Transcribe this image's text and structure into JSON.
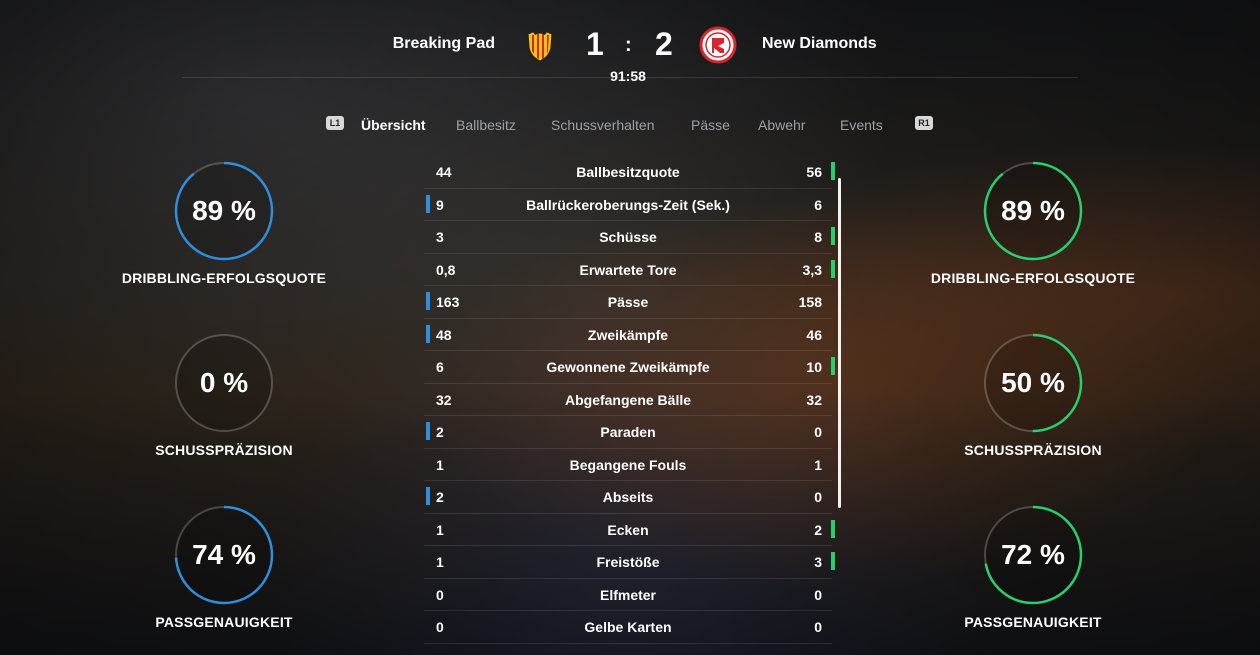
{
  "match": {
    "home_team": "Breaking Pad",
    "away_team": "New Diamonds",
    "home_score": "1",
    "separator": ":",
    "away_score": "2",
    "clock": "91:58"
  },
  "tabs": {
    "left_button": "L1",
    "right_button": "R1",
    "items": [
      "Übersicht",
      "Ballbesitz",
      "Schussverhalten",
      "Pässe",
      "Abwehr",
      "Events"
    ],
    "active": "Übersicht"
  },
  "colors": {
    "home_accent": "#2d8fde",
    "away_accent": "#27d06a"
  },
  "home_rings": [
    {
      "value": "89 %",
      "fraction": 0.89,
      "label": "DRIBBLING-ERFOLGSQUOTE"
    },
    {
      "value": "0 %",
      "fraction": 0.0,
      "label": "SCHUSSPRÄZISION"
    },
    {
      "value": "74 %",
      "fraction": 0.74,
      "label": "PASSGENAUIGKEIT"
    }
  ],
  "away_rings": [
    {
      "value": "89 %",
      "fraction": 0.89,
      "label": "DRIBBLING-ERFOLGSQUOTE"
    },
    {
      "value": "50 %",
      "fraction": 0.5,
      "label": "SCHUSSPRÄZISION"
    },
    {
      "value": "72 %",
      "fraction": 0.72,
      "label": "PASSGENAUIGKEIT"
    }
  ],
  "stats": [
    {
      "home": "44",
      "name": "Ballbesitzquote",
      "away": "56",
      "leader": "away"
    },
    {
      "home": "9",
      "name": "Ballrückeroberungs-Zeit (Sek.)",
      "away": "6",
      "leader": "home"
    },
    {
      "home": "3",
      "name": "Schüsse",
      "away": "8",
      "leader": "away"
    },
    {
      "home": "0,8",
      "name": "Erwartete Tore",
      "away": "3,3",
      "leader": "away"
    },
    {
      "home": "163",
      "name": "Pässe",
      "away": "158",
      "leader": "home"
    },
    {
      "home": "48",
      "name": "Zweikämpfe",
      "away": "46",
      "leader": "home"
    },
    {
      "home": "6",
      "name": "Gewonnene Zweikämpfe",
      "away": "10",
      "leader": "away"
    },
    {
      "home": "32",
      "name": "Abgefangene Bälle",
      "away": "32",
      "leader": "none"
    },
    {
      "home": "2",
      "name": "Paraden",
      "away": "0",
      "leader": "home"
    },
    {
      "home": "1",
      "name": "Begangene Fouls",
      "away": "1",
      "leader": "none"
    },
    {
      "home": "2",
      "name": "Abseits",
      "away": "0",
      "leader": "home"
    },
    {
      "home": "1",
      "name": "Ecken",
      "away": "2",
      "leader": "away"
    },
    {
      "home": "1",
      "name": "Freistöße",
      "away": "3",
      "leader": "away"
    },
    {
      "home": "0",
      "name": "Elfmeter",
      "away": "0",
      "leader": "none"
    },
    {
      "home": "0",
      "name": "Gelbe Karten",
      "away": "0",
      "leader": "none"
    }
  ]
}
